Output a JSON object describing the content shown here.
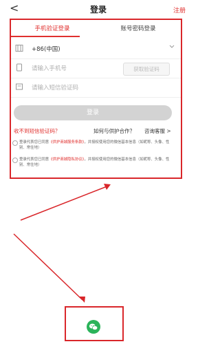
{
  "nav": {
    "back_glyph": "<",
    "title": "登录",
    "register": "注册"
  },
  "tabs": {
    "active": "手机验证登录",
    "inactive": "账号密码登录"
  },
  "country": {
    "value": "+86(中国)"
  },
  "phone": {
    "placeholder": "请输入手机号",
    "code_button": "获取验证码"
  },
  "sms": {
    "placeholder": "请输入短信验证码"
  },
  "login_button": "登录",
  "help": {
    "no_sms": "收不到短信验证码？",
    "partner": "如何与供护合作？",
    "consult": "咨询客服 >"
  },
  "agreements": [
    {
      "pre": "登录代表您已同意",
      "link": "《供护商城服务条款》",
      "post": "，并授权使用您的微信基本信息（如昵称、头像、性别、常住地）"
    },
    {
      "pre": "登录代表您已同意",
      "link": "《供护商城隐私协议》",
      "post": "，并授权使用您的微信基本信息（如昵称、头像、性别、常住地）"
    }
  ],
  "colors": {
    "accent": "#e0302e",
    "annotation": "#d9262a",
    "wechat": "#2bb35a"
  },
  "icons": {
    "back": "chevron-left-icon",
    "globe": "globe-icon",
    "phone": "phone-icon",
    "sms": "message-icon",
    "dropdown": "chevron-down-icon",
    "wechat": "wechat-icon"
  }
}
